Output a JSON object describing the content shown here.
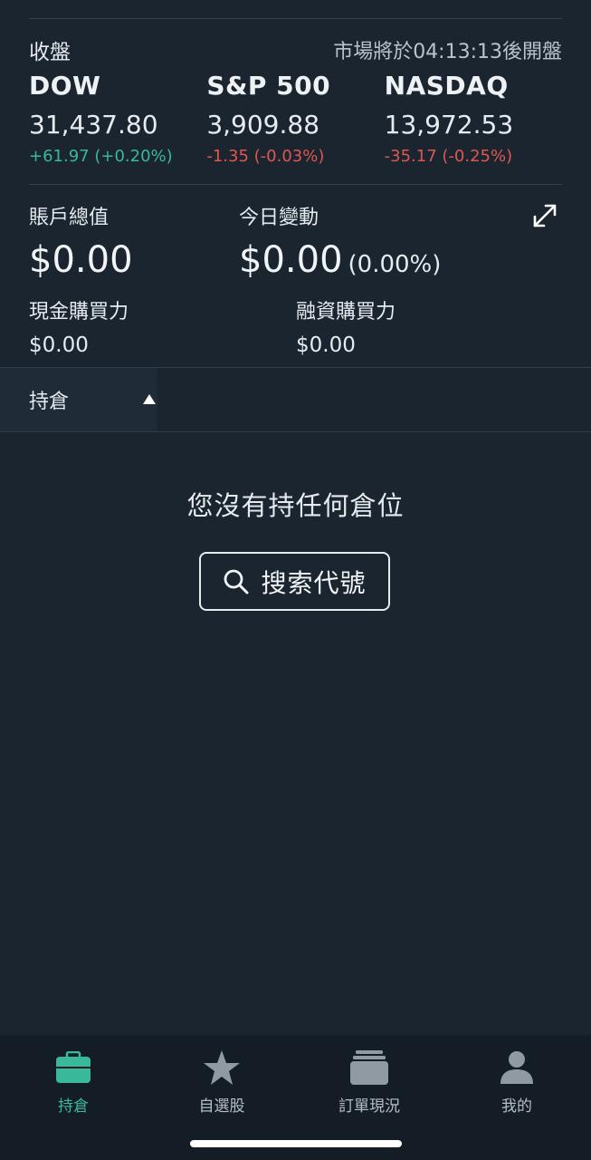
{
  "market": {
    "session_label": "收盤",
    "open_status": "市場將於04:13:13後開盤",
    "indices": [
      {
        "name": "DOW",
        "value": "31,437.80",
        "change": "+61.97 (+0.20%)",
        "direction": "up"
      },
      {
        "name": "S&P 500",
        "value": "3,909.88",
        "change": "-1.35 (-0.03%)",
        "direction": "down"
      },
      {
        "name": "NASDAQ",
        "value": "13,972.53",
        "change": "-35.17 (-0.25%)",
        "direction": "down"
      }
    ]
  },
  "account": {
    "total_label": "賬戶總值",
    "total_value": "$0.00",
    "today_label": "今日變動",
    "today_value": "$0.00",
    "today_pct": "(0.00%)",
    "cash_bp_label": "現金購買力",
    "cash_bp_value": "$0.00",
    "margin_bp_label": "融資購買力",
    "margin_bp_value": "$0.00"
  },
  "positions": {
    "tab_label": "持倉",
    "empty_message": "您沒有持任何倉位",
    "search_button": "搜索代號"
  },
  "nav": {
    "items": [
      {
        "label": "持倉",
        "icon": "briefcase-icon",
        "active": true
      },
      {
        "label": "自選股",
        "icon": "star-icon",
        "active": false
      },
      {
        "label": "訂單現況",
        "icon": "orders-stack-icon",
        "active": false
      },
      {
        "label": "我的",
        "icon": "user-icon",
        "active": false
      }
    ]
  },
  "colors": {
    "background": "#1a2530",
    "positive": "#39b89a",
    "negative": "#e0574f",
    "accent": "#39b89a"
  }
}
